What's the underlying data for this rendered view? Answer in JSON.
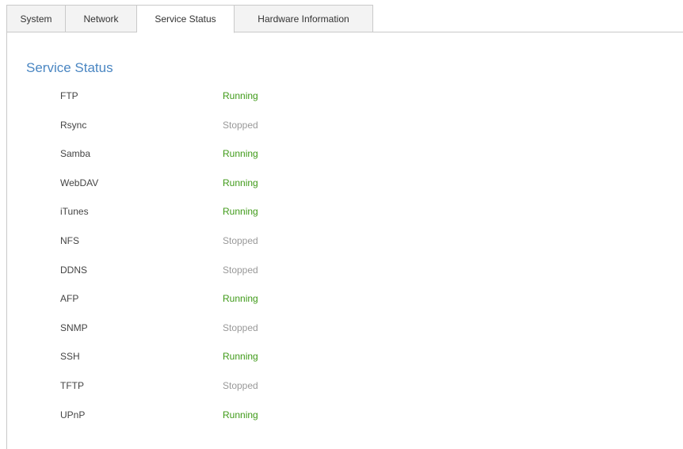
{
  "tabs": [
    {
      "label": "System"
    },
    {
      "label": "Network"
    },
    {
      "label": "Service Status"
    },
    {
      "label": "Hardware Information"
    }
  ],
  "active_tab": "Service Status",
  "section": {
    "title": "Service Status"
  },
  "colors": {
    "running": "#3f9a18",
    "stopped": "#999999",
    "title": "#4a86c2"
  },
  "services": [
    {
      "name": "FTP",
      "status": "Running"
    },
    {
      "name": "Rsync",
      "status": "Stopped"
    },
    {
      "name": "Samba",
      "status": "Running"
    },
    {
      "name": "WebDAV",
      "status": "Running"
    },
    {
      "name": "iTunes",
      "status": "Running"
    },
    {
      "name": "NFS",
      "status": "Stopped"
    },
    {
      "name": "DDNS",
      "status": "Stopped"
    },
    {
      "name": "AFP",
      "status": "Running"
    },
    {
      "name": "SNMP",
      "status": "Stopped"
    },
    {
      "name": "SSH",
      "status": "Running"
    },
    {
      "name": "TFTP",
      "status": "Stopped"
    },
    {
      "name": "UPnP",
      "status": "Running"
    }
  ]
}
